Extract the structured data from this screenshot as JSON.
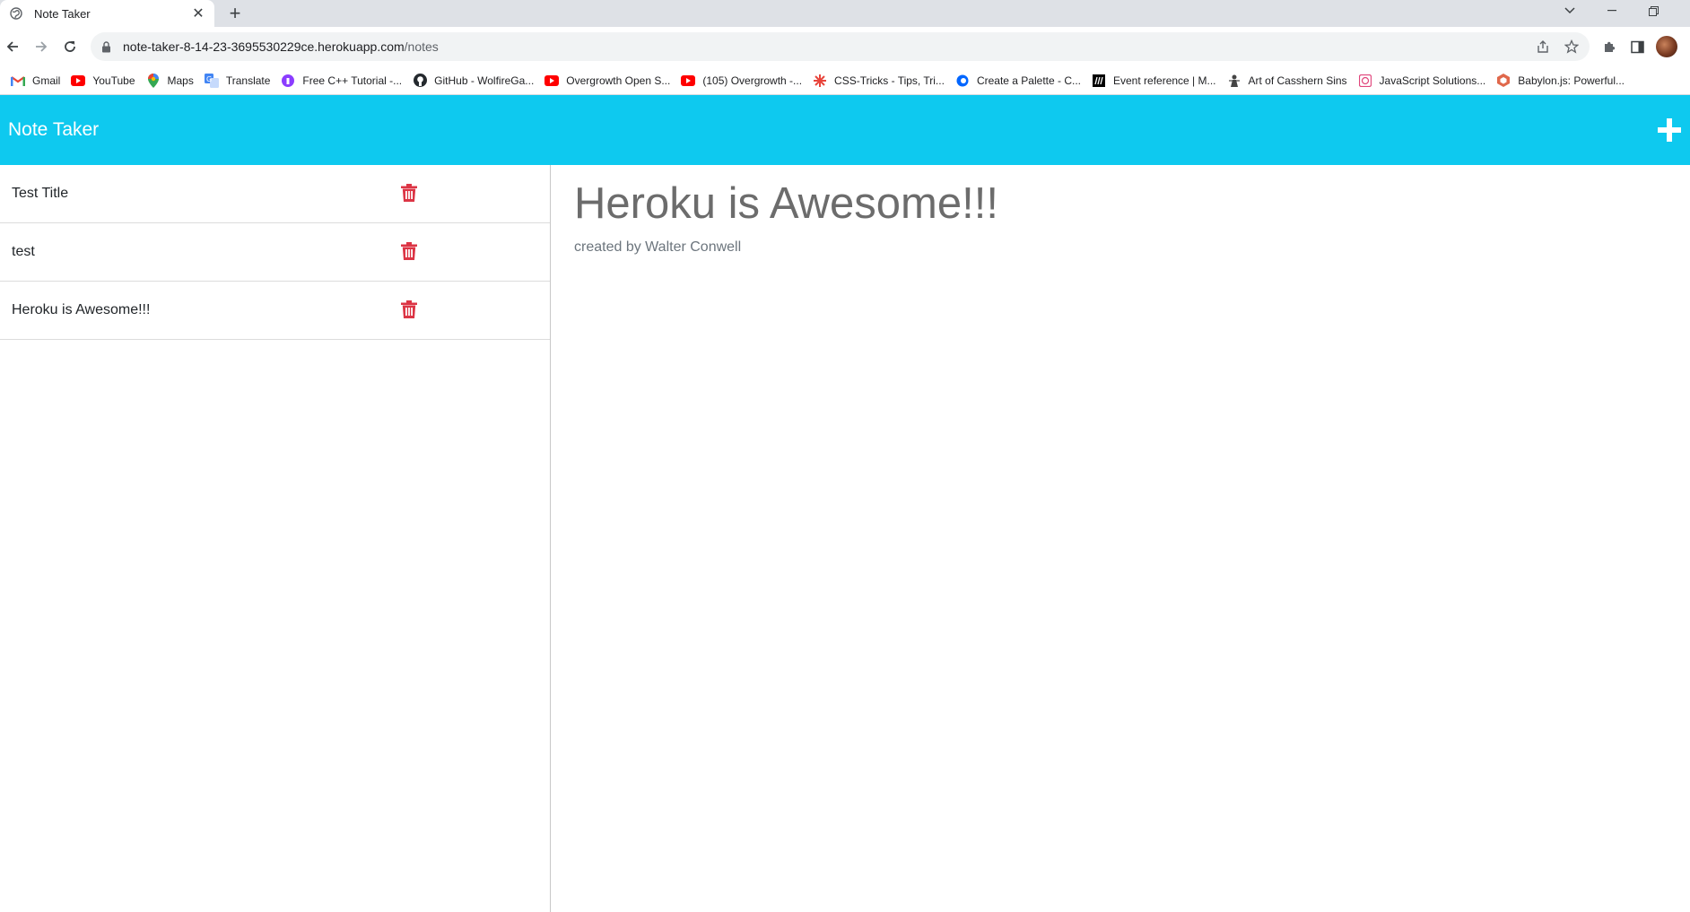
{
  "browser": {
    "tab": {
      "title": "Note Taker"
    },
    "url": {
      "host": "note-taker-8-14-23-3695530229ce.herokuapp.com",
      "path": "/notes"
    },
    "bookmarks": [
      {
        "label": "Gmail",
        "icon": "gmail-icon"
      },
      {
        "label": "YouTube",
        "icon": "youtube-icon"
      },
      {
        "label": "Maps",
        "icon": "maps-icon"
      },
      {
        "label": "Translate",
        "icon": "translate-icon"
      },
      {
        "label": "Free C++ Tutorial -...",
        "icon": "course-icon"
      },
      {
        "label": "GitHub - WolfireGa...",
        "icon": "github-icon"
      },
      {
        "label": "Overgrowth Open S...",
        "icon": "youtube-icon"
      },
      {
        "label": "(105) Overgrowth -...",
        "icon": "youtube-icon"
      },
      {
        "label": "CSS-Tricks - Tips, Tri...",
        "icon": "css-tricks-icon"
      },
      {
        "label": "Create a Palette - C...",
        "icon": "coolors-icon"
      },
      {
        "label": "Event reference | M...",
        "icon": "mdn-icon"
      },
      {
        "label": "Art of Casshern Sins",
        "icon": "art-icon"
      },
      {
        "label": "JavaScript Solutions...",
        "icon": "js-solutions-icon"
      },
      {
        "label": "Babylon.js: Powerful...",
        "icon": "babylon-icon"
      }
    ]
  },
  "app": {
    "brand": "Note Taker",
    "notes": [
      {
        "title": "Test Title"
      },
      {
        "title": "test"
      },
      {
        "title": "Heroku is Awesome!!!"
      }
    ],
    "active_note": {
      "title": "Heroku is Awesome!!!",
      "text": "created by Walter Conwell"
    },
    "colors": {
      "navbar": "#0ec9ef",
      "trash": "#dc3545"
    }
  }
}
